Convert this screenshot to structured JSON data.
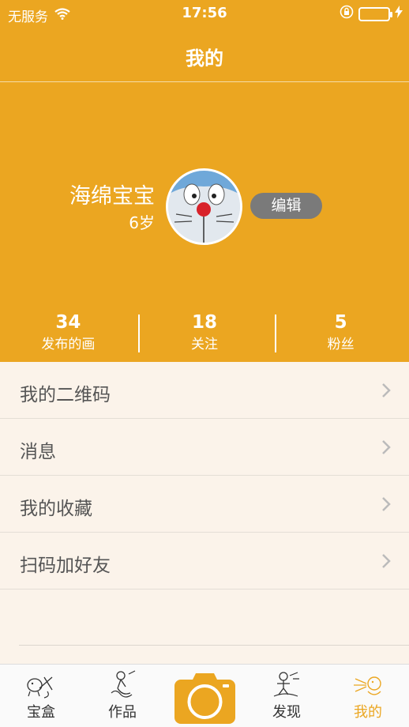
{
  "status_bar": {
    "carrier": "无服务",
    "time": "17:56",
    "battery_color": "#7BE33B"
  },
  "nav": {
    "title": "我的"
  },
  "profile": {
    "name": "海绵宝宝",
    "age": "6岁",
    "edit_label": "编辑",
    "avatar_icon": "doraemon-avatar"
  },
  "stats": [
    {
      "value": "34",
      "label": "发布的画"
    },
    {
      "value": "18",
      "label": "关注"
    },
    {
      "value": "5",
      "label": "粉丝"
    }
  ],
  "menu": [
    {
      "label": "我的二维码"
    },
    {
      "label": "消息"
    },
    {
      "label": "我的收藏"
    },
    {
      "label": "扫码加好友"
    }
  ],
  "tabs": [
    {
      "label": "宝盒",
      "icon": "treasure-box-icon"
    },
    {
      "label": "作品",
      "icon": "works-icon"
    },
    {
      "label": "",
      "icon": "camera-icon"
    },
    {
      "label": "发现",
      "icon": "discover-icon"
    },
    {
      "label": "我的",
      "icon": "me-icon",
      "active": true
    }
  ],
  "colors": {
    "accent": "#EBA621",
    "background": "#FBF3EA",
    "edit_button": "#7A7A7A"
  }
}
